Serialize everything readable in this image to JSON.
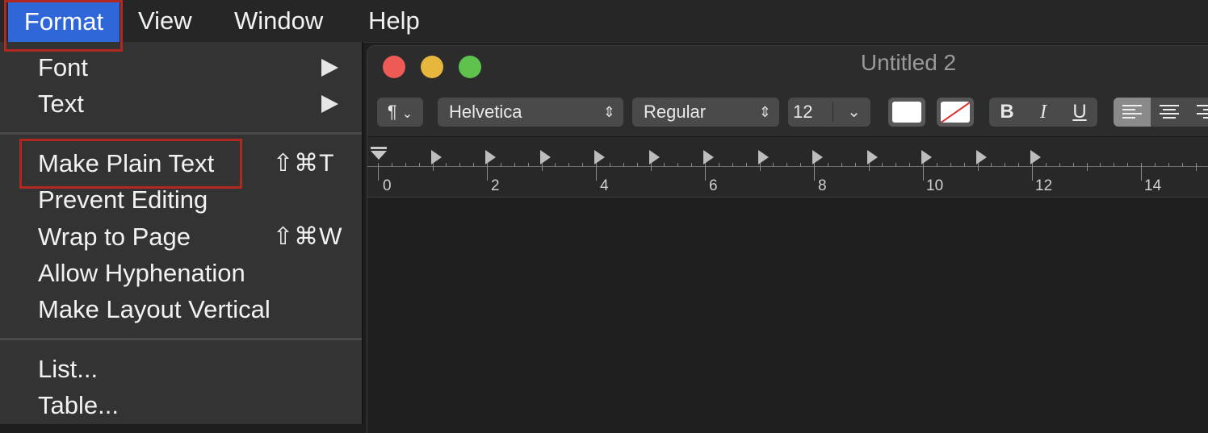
{
  "menubar": {
    "items": [
      "Format",
      "View",
      "Window",
      "Help"
    ],
    "active": "Format"
  },
  "format_menu": {
    "items": [
      {
        "label": "Font",
        "submenu": true
      },
      {
        "label": "Text",
        "submenu": true
      },
      {
        "label": "Make Plain Text",
        "shortcut": "⇧⌘T"
      },
      {
        "label": "Prevent Editing"
      },
      {
        "label": "Wrap to Page",
        "shortcut": "⇧⌘W"
      },
      {
        "label": "Allow Hyphenation"
      },
      {
        "label": "Make Layout Vertical"
      },
      {
        "label": "List..."
      },
      {
        "label": "Table..."
      }
    ]
  },
  "window": {
    "title": "Untitled 2",
    "toolbar": {
      "paragraph_icon": "¶",
      "font_family": "Helvetica",
      "typeface": "Regular",
      "font_size": "12",
      "bold": "B",
      "italic": "I",
      "underline": "U"
    },
    "ruler": {
      "labels": [
        "0",
        "2",
        "4",
        "6",
        "8",
        "10",
        "12",
        "14"
      ]
    }
  },
  "colors": {
    "menu_highlight": "#2f67d9",
    "annotation_box": "#b0281f",
    "close": "#ee5b55",
    "minimize": "#e6b73c",
    "zoom": "#5fc24c"
  }
}
